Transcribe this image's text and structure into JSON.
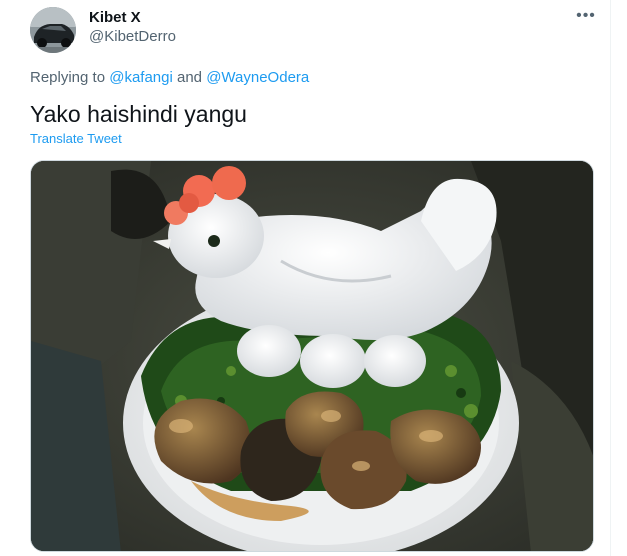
{
  "tweet": {
    "author": {
      "display_name": "Kibet X",
      "handle": "@KibetDerro",
      "avatar": "avatar-car-photo"
    },
    "more_icon": "more-horizontal-icon",
    "reply": {
      "prefix": "Replying to",
      "mention_1": "@kafangi",
      "joiner": "and",
      "mention_2": "@WayneOdera"
    },
    "text": "Yako haishindi yangu",
    "translate_label": "Translate Tweet",
    "media": {
      "kind": "photo",
      "subject": "hen-shaped-rice-plate-photo"
    },
    "colors": {
      "link": "#1d9bf0",
      "secondary_text": "#536471",
      "primary_text": "#0f1419"
    }
  }
}
